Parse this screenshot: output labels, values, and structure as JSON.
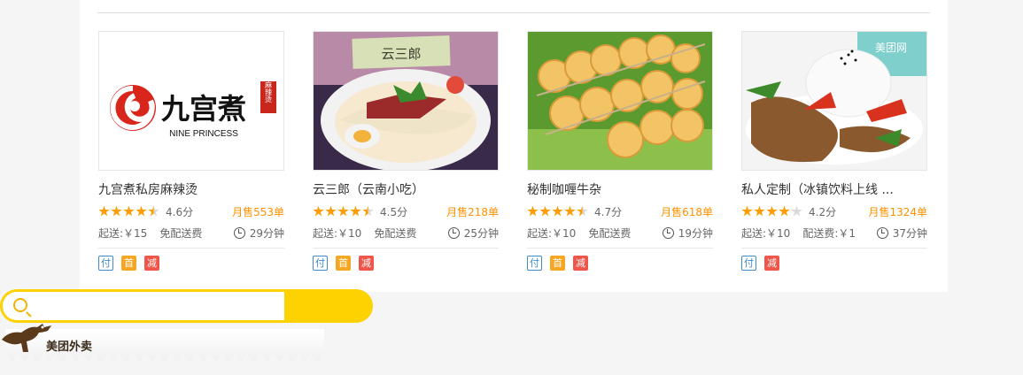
{
  "restaurants": [
    {
      "name": "九宫煮私房麻辣烫",
      "rating": 4.6,
      "rating_text": "4.6分",
      "stars": [
        "full",
        "full",
        "full",
        "full",
        "half"
      ],
      "sales": "月售553单",
      "min_order": "起送:￥15",
      "delivery_fee": "免配送费",
      "delivery_time": "29分钟",
      "badges": [
        "付",
        "首",
        "减"
      ],
      "logo": {
        "cn": "九宫煮",
        "en": "NINE PRINCESS",
        "seal": "麻辣烫"
      }
    },
    {
      "name": "云三郎（云南小吃）",
      "rating": 4.5,
      "rating_text": "4.5分",
      "stars": [
        "full",
        "full",
        "full",
        "full",
        "half"
      ],
      "sales": "月售218单",
      "min_order": "起送:￥10",
      "delivery_fee": "免配送费",
      "delivery_time": "25分钟",
      "badges": [
        "付",
        "首",
        "减"
      ],
      "photo_sign": "云三郎"
    },
    {
      "name": "秘制咖喱牛杂",
      "rating": 4.7,
      "rating_text": "4.7分",
      "stars": [
        "full",
        "full",
        "full",
        "full",
        "half"
      ],
      "sales": "月售618单",
      "min_order": "起送:￥10",
      "delivery_fee": "免配送费",
      "delivery_time": "19分钟",
      "badges": [
        "付",
        "首",
        "减"
      ]
    },
    {
      "name": "私人定制（冰镇饮料上线 ...",
      "rating": 4.2,
      "rating_text": "4.2分",
      "stars": [
        "full",
        "full",
        "full",
        "full",
        "empty"
      ],
      "sales": "月售1324单",
      "min_order": "起送:￥10",
      "delivery_fee": "配送费:￥1",
      "delivery_time": "37分钟",
      "badges": [
        "付",
        "减"
      ],
      "photo_watermark": "美团网"
    }
  ],
  "search": {
    "placeholder": ""
  },
  "brand": {
    "name": "美团外卖"
  },
  "colors": {
    "accent": "#fdd200",
    "sales": "#ff9100",
    "star": "#ff9d00"
  }
}
